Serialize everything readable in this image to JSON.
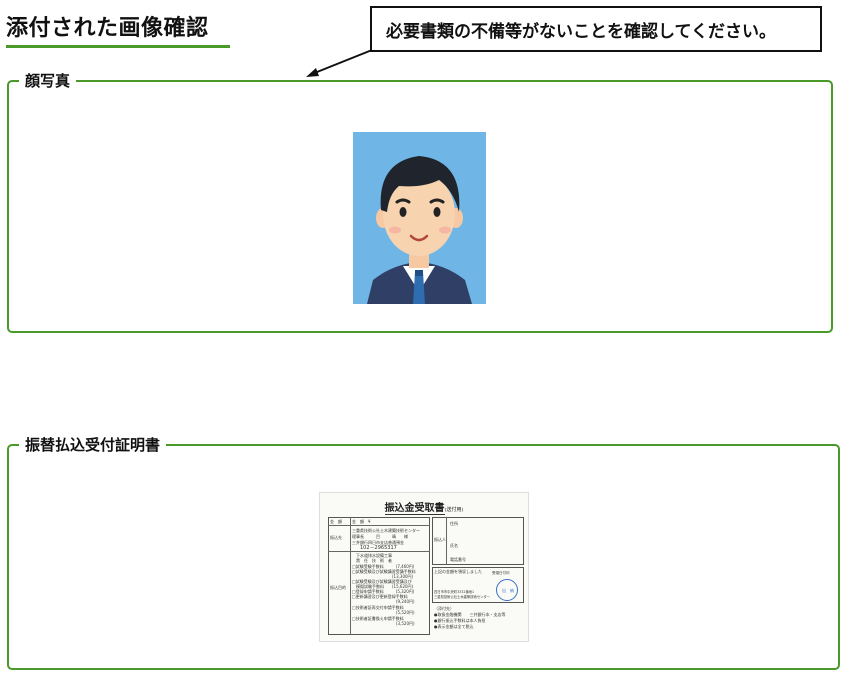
{
  "header": {
    "title": "添付された画像確認",
    "callout": "必要書類の不備等がないことを確認してください。"
  },
  "photo_panel": {
    "legend": "顔写真"
  },
  "receipt_panel": {
    "legend": "振替払込受付証明書",
    "receipt": {
      "title": "振込金受取書",
      "title_sub": "(送付用)",
      "lines_left": [
        "金　額　¥",
        "三重県技術公社土木建築技術センター",
        "理事長　　　目　　　晴　　様",
        "三井銀行四日市支店普通預金",
        "102－2965317",
        "下水道排水設備工事",
        "責　任　技　術　者",
        "□試験受験手数料　　　(7,460円)",
        "□試験受験及び試験講習受講手数料",
        "　　　　　　　　　　(13,300円)",
        "□試験受験及び試験講習受講及び",
        "　模擬試験手数料　　(15,620円)",
        "□登録申請手数料　　　(5,320円)",
        "□更新講習及び更新登録手数料",
        "　　　　　　　　　　　(9,240円)",
        "□技術者証再交付申請手数料",
        "　　　　　　　　　　　(5,520円)",
        "□技術者証書換え申請手数料",
        "　　　　　　　　　　　(3,520円)"
      ],
      "left_row_labels": [
        "金　額",
        "振込先",
        "振込目的"
      ],
      "right_labels": [
        "住所",
        "振込人",
        "氏名",
        "電話番号"
      ],
      "confirm_text": "上記の金額を領収しました",
      "address_text": "四日市市中央町3332番地1",
      "org_text": "三重県技術公社土木建築技術センター",
      "notes": [
        "（添付先）",
        "●取扱金融機関　　三井銀行本・支店等",
        "●銀行振込手数料は本人負担",
        "●表示金額は全て税込"
      ],
      "stamp_label": "受領日付印",
      "stamp_text": "出　納"
    }
  },
  "colors": {
    "accent": "#4a9a2a",
    "photo_bg": "#6fb6e6",
    "stamp": "#3b6fc6"
  }
}
